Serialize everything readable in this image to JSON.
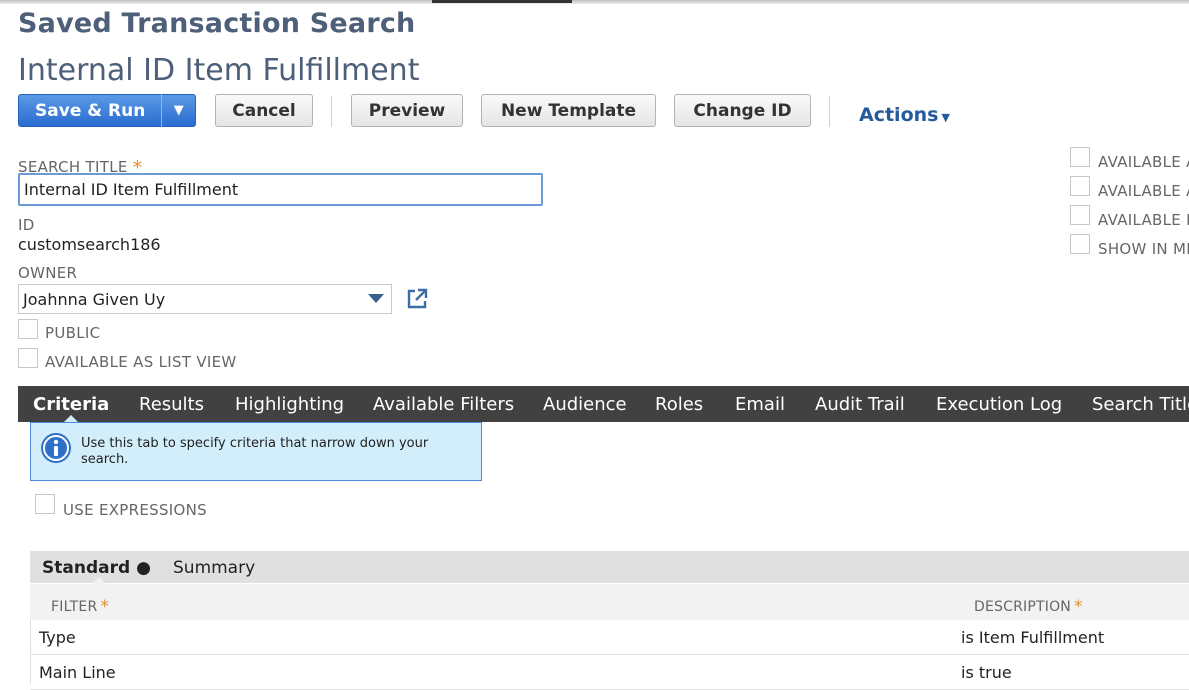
{
  "page": {
    "header": "Saved Transaction Search",
    "record_title": "Internal ID Item Fulfillment"
  },
  "toolbar": {
    "save_run": "Save & Run",
    "save_run_caret": "▼",
    "cancel": "Cancel",
    "preview": "Preview",
    "new_template": "New Template",
    "change_id": "Change ID",
    "actions": "Actions",
    "actions_caret": "▼"
  },
  "form": {
    "search_title_label": "SEARCH TITLE",
    "required_mark": "*",
    "search_title_value": "Internal ID Item Fulfillment",
    "id_label": "ID",
    "id_value": "customsearch186",
    "owner_label": "OWNER",
    "owner_value": "Joahnna Given Uy",
    "public_label": "PUBLIC",
    "public_checked": false,
    "list_view_label": "AVAILABLE AS LIST VIEW",
    "list_view_checked": false
  },
  "right_options": [
    {
      "label": "AVAILABLE A",
      "checked": false
    },
    {
      "label": "AVAILABLE A",
      "checked": false
    },
    {
      "label": "AVAILABLE I",
      "checked": false
    },
    {
      "label": "SHOW IN MI",
      "checked": false
    }
  ],
  "tabs": [
    {
      "label": "Criteria",
      "active": true
    },
    {
      "label": "Results"
    },
    {
      "label": "Highlighting"
    },
    {
      "label": "Available Filters"
    },
    {
      "label": "Audience"
    },
    {
      "label": "Roles"
    },
    {
      "label": "Email"
    },
    {
      "label": "Audit Trail"
    },
    {
      "label": "Execution Log"
    },
    {
      "label": "Search Title"
    }
  ],
  "info": {
    "text": "Use this tab to specify criteria that narrow down your search.",
    "icon": "info-icon"
  },
  "use_expressions": {
    "label": "USE EXPRESSIONS",
    "checked": false
  },
  "subtabs": [
    {
      "label": "Standard",
      "marker": "●",
      "active": true
    },
    {
      "label": "Summary"
    }
  ],
  "grid": {
    "columns": [
      "FILTER",
      "DESCRIPTION"
    ],
    "required_mark": "*",
    "rows": [
      {
        "filter": "Type",
        "description": "is Item Fulfillment"
      },
      {
        "filter": "Main Line",
        "description": "is true"
      }
    ]
  },
  "colors": {
    "primary_button": "#3a7fdc",
    "tab_bar": "#414141",
    "info_bg": "#d2eefa",
    "header_text": "#4d5f79",
    "required": "#e08f2a",
    "link": "#255a9c"
  }
}
